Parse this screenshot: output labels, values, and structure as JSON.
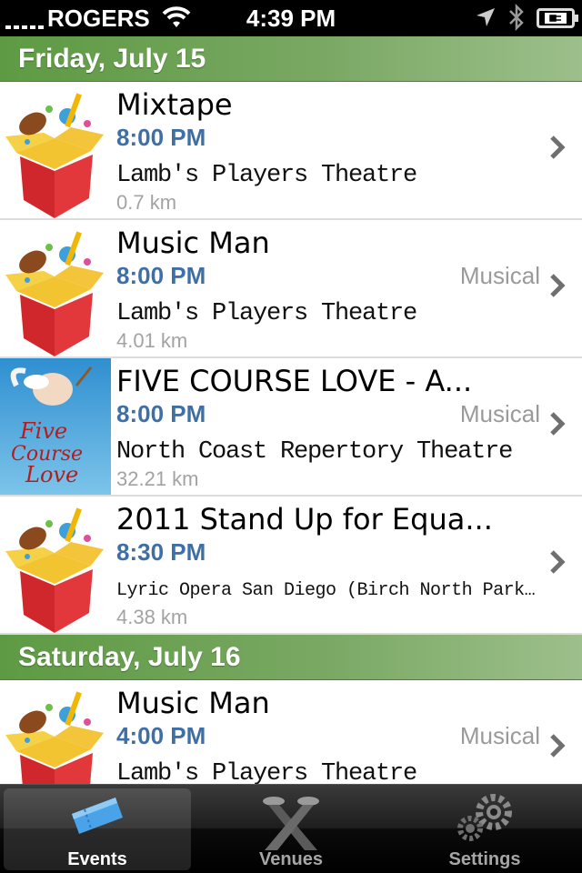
{
  "status_bar": {
    "carrier": "ROGERS",
    "time": "4:39 PM"
  },
  "sections": [
    {
      "header": "Friday, July 15",
      "events": [
        {
          "title": "Mixtape",
          "time": "8:00 PM",
          "genre": "",
          "venue": "Lamb's Players Theatre",
          "distance": "0.7 km",
          "thumbnail": "gift-box-icon"
        },
        {
          "title": "Music Man",
          "time": "8:00 PM",
          "genre": "Musical",
          "venue": "Lamb's Players Theatre",
          "distance": "4.01 km",
          "thumbnail": "gift-box-icon"
        },
        {
          "title": "FIVE COURSE LOVE - A...",
          "time": "8:00 PM",
          "genre": "Musical",
          "venue": "North Coast Repertory Theatre",
          "distance": "32.21 km",
          "thumbnail": "five-course-love-poster",
          "poster_text": [
            "Five",
            "Course",
            "Love"
          ]
        },
        {
          "title": "2011 Stand Up for Equa...",
          "time": "8:30 PM",
          "genre": "",
          "venue": "Lyric Opera San Diego (Birch North Park Th...",
          "distance": "4.38 km",
          "thumbnail": "gift-box-icon"
        }
      ]
    },
    {
      "header": "Saturday, July 16",
      "events": [
        {
          "title": "Music Man",
          "time": "4:00 PM",
          "genre": "Musical",
          "venue": "Lamb's Players Theatre",
          "distance": "",
          "thumbnail": "gift-box-icon"
        }
      ]
    }
  ],
  "tab_bar": {
    "tabs": [
      {
        "label": "Events",
        "icon": "ticket-icon",
        "active": true
      },
      {
        "label": "Venues",
        "icon": "spotlights-icon",
        "active": false
      },
      {
        "label": "Settings",
        "icon": "gears-icon",
        "active": false
      }
    ]
  },
  "colors": {
    "section_header": "#6fa35a",
    "time_text": "#3e6fa5",
    "tab_bar": "#1a1a1a"
  }
}
